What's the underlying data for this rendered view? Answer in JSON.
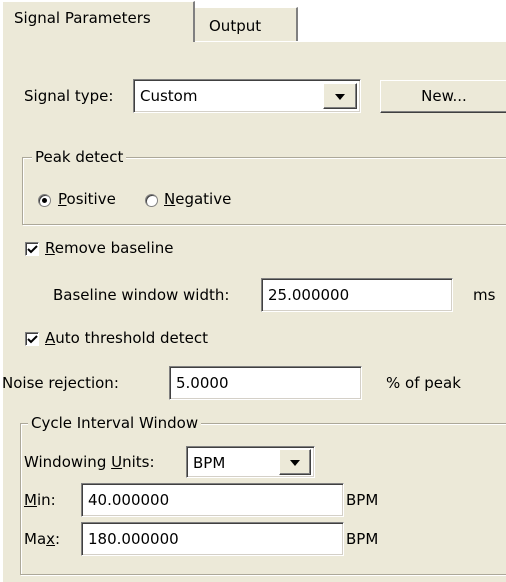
{
  "tabs": [
    {
      "label": "Signal Parameters",
      "active": true
    },
    {
      "label": "Output",
      "active": false
    }
  ],
  "signal_type": {
    "label": "Signal type:",
    "value": "Custom",
    "new_button": "New..."
  },
  "peak_detect": {
    "title": "Peak detect",
    "positive": {
      "mnemonic": "P",
      "rest": "ositive",
      "checked": true
    },
    "negative": {
      "mnemonic": "N",
      "rest": "egative",
      "checked": false
    }
  },
  "remove_baseline": {
    "mnemonic": "R",
    "rest": "emove baseline",
    "checked": true,
    "width_label": "Baseline window width:",
    "width_value": "25.000000",
    "width_unit": "ms"
  },
  "auto_threshold": {
    "mnemonic": "A",
    "rest": "uto threshold detect",
    "checked": true
  },
  "noise_rejection": {
    "label": "Noise rejection:",
    "value": "5.0000",
    "unit": "% of peak"
  },
  "cycle_interval": {
    "title": "Cycle Interval Window",
    "units_label_pre": "Windowing ",
    "units_label_mnemonic": "U",
    "units_label_post": "nits:",
    "units_value": "BPM",
    "min_mnemonic": "M",
    "min_label_rest": "in:",
    "min_value": "40.000000",
    "min_unit": "BPM",
    "max_label_pre": "Ma",
    "max_mnemonic": "x",
    "max_label_post": ":",
    "max_value": "180.000000",
    "max_unit": "BPM"
  },
  "colors": {
    "panel": "#ece9d8",
    "field": "#ffffff"
  }
}
